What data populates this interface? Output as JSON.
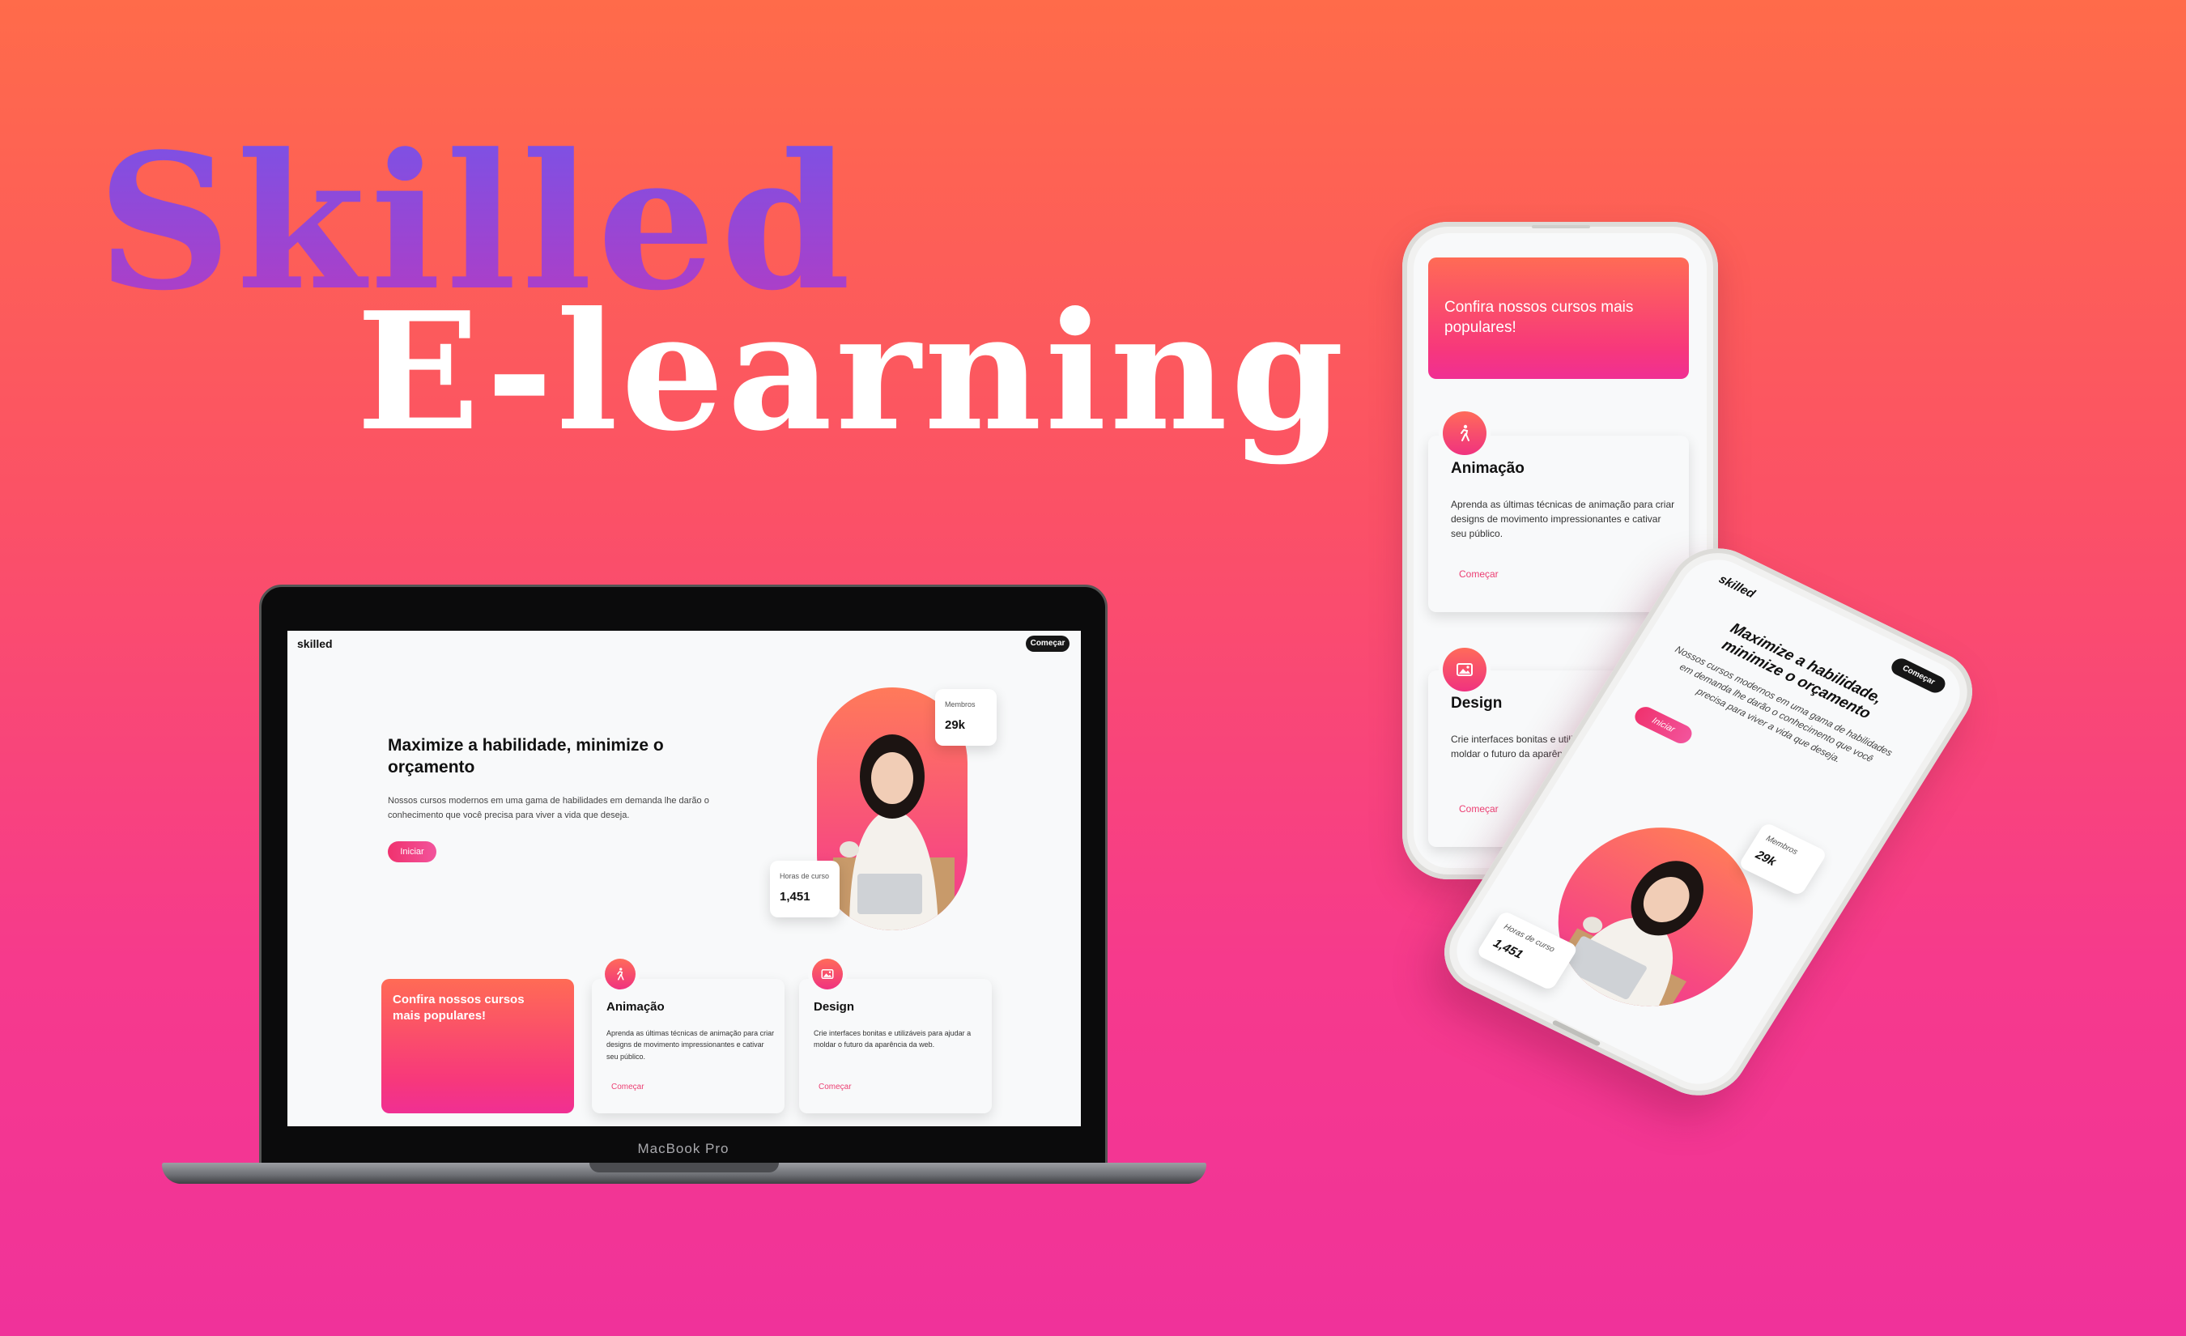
{
  "hero": {
    "line1": "Skilled",
    "line2": "E-learning"
  },
  "laptop": {
    "model": "MacBook Pro",
    "screen": {
      "logo": "skilled",
      "cta_top": "Começar",
      "headline": "Maximize a habilidade, minimize o orçamento",
      "description": "Nossos cursos modernos em uma gama de habilidades em demanda lhe darão o conhecimento que você precisa para viver a vida que deseja.",
      "cta_main": "Iniciar",
      "stats": [
        {
          "label": "Membros",
          "value": "29k"
        },
        {
          "label": "Horas de curso",
          "value": "1,451"
        }
      ],
      "promo": "Confira nossos cursos mais populares!",
      "courses": [
        {
          "title": "Animação",
          "icon": "walking-person-icon",
          "description": "Aprenda as últimas técnicas de animação para criar designs de movimento impressionantes e cativar seu público.",
          "link": "Começar"
        },
        {
          "title": "Design",
          "icon": "image-icon",
          "description": "Crie interfaces bonitas e utilizáveis para ajudar a moldar o futuro da aparência da web.",
          "link": "Começar"
        }
      ]
    }
  },
  "phone_front": {
    "promo": "Confira nossos cursos mais populares!",
    "courses": [
      {
        "title": "Animação",
        "icon": "walking-person-icon",
        "description": "Aprenda as últimas técnicas de animação para criar designs de movimento impressionantes e cativar seu público.",
        "link": "Começar"
      },
      {
        "title": "Design",
        "icon": "image-icon",
        "description": "Crie interfaces bonitas e utilizáveis para ajudar a moldar o futuro da aparência da web.",
        "link": "Começar"
      }
    ]
  },
  "phone_tilted": {
    "logo": "skilled",
    "cta_top": "Começar",
    "headline": "Maximize a habilidade, minimize o orçamento",
    "description": "Nossos cursos modernos em uma gama de habilidades em demanda lhe darão o conhecimento que você precisa para viver a vida que deseja.",
    "cta_main": "Iniciar",
    "stats": [
      {
        "label": "Membros",
        "value": "29k"
      },
      {
        "label": "Horas de curso",
        "value": "1,451"
      }
    ]
  },
  "colors": {
    "background_top": "#ff6b4a",
    "background_bottom": "#f0329a",
    "title_purple": "#7a52e6",
    "accent_pink": "#f0326e",
    "button_dark": "#161616"
  }
}
